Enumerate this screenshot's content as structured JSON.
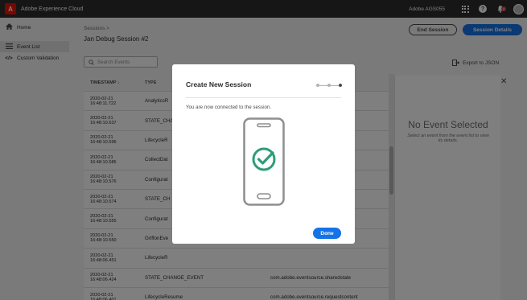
{
  "topbar": {
    "app_title": "Adobe Experience Cloud",
    "org_name": "Adobe AGS055",
    "notification_count": "2"
  },
  "sidebar": {
    "items": [
      {
        "label": "Home",
        "icon": "home-icon"
      },
      {
        "label": "Event List",
        "icon": "list-icon"
      },
      {
        "label": "Custom Validation",
        "icon": "code-icon"
      }
    ]
  },
  "main": {
    "breadcrumb": "Sessions  >",
    "title": "Jan Debug Session #2",
    "end_session_label": "End Session",
    "session_details_label": "Session Details",
    "search_placeholder": "Search Events",
    "export_label": "Export to JSON"
  },
  "table": {
    "headers": [
      "TIMESTAMP",
      "TYPE"
    ],
    "rows": [
      {
        "timestamp": "2020-02-21 16:48:11.722",
        "type": "AnalyticsR",
        "source": "nt"
      },
      {
        "timestamp": "2020-02-21 16:48:10.637",
        "type": "STATE_CHA",
        "source": ""
      },
      {
        "timestamp": "2020-02-21 16:48:10.596",
        "type": "LifecycleR",
        "source": ""
      },
      {
        "timestamp": "2020-02-21 16:48:10.585",
        "type": "CollectDat",
        "source": ""
      },
      {
        "timestamp": "2020-02-21 16:48:10.576",
        "type": "Configurat",
        "source": "nt"
      },
      {
        "timestamp": "2020-02-21 16:48:10.574",
        "type": "STATE_CH",
        "source": ""
      },
      {
        "timestamp": "2020-02-21 16:48:10.555",
        "type": "Configurat",
        "source": ""
      },
      {
        "timestamp": "2020-02-21 16:48:10.550",
        "type": "GriffonEve",
        "source": ""
      },
      {
        "timestamp": "2020-02-21 16:48:06.451",
        "type": "LifecycleR",
        "source": ""
      },
      {
        "timestamp": "2020-02-21 16:48:06.424",
        "type": "STATE_CHANGE_EVENT",
        "source": "com.adobe.eventsource.sharedstate"
      },
      {
        "timestamp": "2020-02-21 16:48:06.401",
        "type": "LifecycleResume",
        "source": "com.adobe.eventsource.requestcontent"
      }
    ]
  },
  "detail_panel": {
    "heading": "No Event Selected",
    "subtext": "Select an event from the event list to view its details."
  },
  "modal": {
    "title": "Create New Session",
    "message": "You are now connected to the session.",
    "done_label": "Done",
    "success_color": "#2d9d78"
  },
  "colors": {
    "accent": "#1473e6",
    "topbar": "#2c2c2c",
    "brand": "#eb1000"
  }
}
